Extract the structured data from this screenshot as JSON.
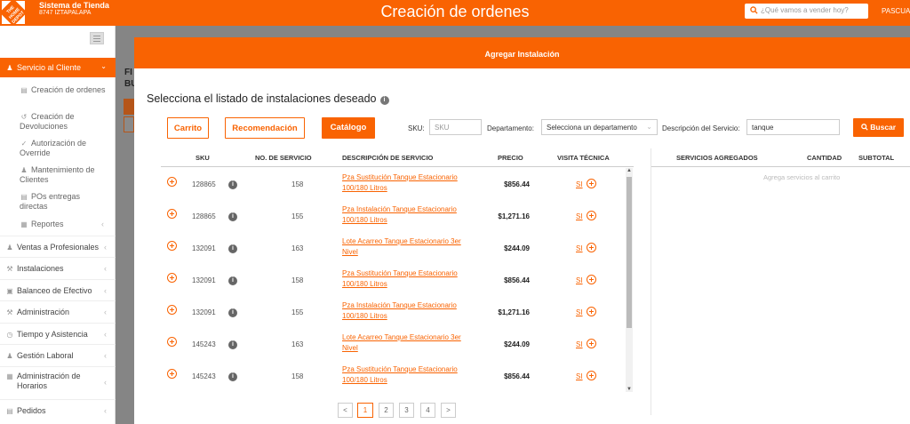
{
  "header": {
    "store_name": "Sistema de Tienda",
    "store_sub": "8747 IZTAPALAPA",
    "logo_text": "THE HOME DEPOT",
    "title": "Creación de ordenes",
    "search_placeholder": "¿Qué vamos a vender hoy?",
    "user": "PASCUAL",
    "brand_color": "#f96302"
  },
  "sidebar": {
    "active": "Servicio al Cliente",
    "subitems": [
      {
        "label": "Creación de ordenes",
        "icon": "list-icon"
      },
      {
        "label": "Creación de Devoluciones",
        "icon": "return-icon"
      },
      {
        "label": "Autorización de Override",
        "icon": "check-icon"
      },
      {
        "label": "Mantenimiento de Clientes",
        "icon": "person-icon"
      },
      {
        "label": "POs entregas directas",
        "icon": "list-icon"
      },
      {
        "label": "Reportes",
        "icon": "clipboard-icon"
      }
    ],
    "items": [
      {
        "label": "Ventas a Profesionales",
        "icon": "person-icon"
      },
      {
        "label": "Instalaciones",
        "icon": "wrench-icon"
      },
      {
        "label": "Balanceo de Efectivo",
        "icon": "cash-icon"
      },
      {
        "label": "Administración",
        "icon": "wrench-icon"
      },
      {
        "label": "Tiempo y Asistencia",
        "icon": "clock-icon"
      },
      {
        "label": "Gestión Laboral",
        "icon": "group-icon"
      },
      {
        "label": "Administración de Horarios",
        "icon": "calendar-icon"
      },
      {
        "label": "Pedidos",
        "icon": "document-icon"
      }
    ]
  },
  "background": {
    "text1": "FI",
    "text2": "BU"
  },
  "modal": {
    "header": "Agregar Instalación",
    "subtitle": "Selecciona el listado de instalaciones deseado",
    "buttons": {
      "carrito": "Carrito",
      "recomendacion": "Recomendación",
      "catalogo": "Catálogo",
      "buscar": "Buscar"
    },
    "filters": {
      "sku_label": "SKU:",
      "sku_placeholder": "SKU",
      "depto_label": "Departamento:",
      "depto_value": "Selecciona un departamento",
      "desc_label": "Descripción del Servicio:",
      "desc_value": "tanque"
    },
    "table": {
      "headers": {
        "sku": "SKU",
        "num": "NO. DE SERVICIO",
        "desc": "DESCRIPCIÓN DE SERVICIO",
        "precio": "PRECIO",
        "visita": "VISITA TÉCNICA"
      },
      "rows": [
        {
          "sku": "128865",
          "num": "158",
          "desc": "Pza Sustitución Tanque Estacionario 100/180 Litros",
          "precio": "$856.44",
          "visita": "SI"
        },
        {
          "sku": "128865",
          "num": "155",
          "desc": "Pza Instalación Tanque Estacionario 100/180 Litros",
          "precio": "$1,271.16",
          "visita": "SI"
        },
        {
          "sku": "132091",
          "num": "163",
          "desc": "Lote Acarreo Tanque Estacionario 3er Nivel",
          "precio": "$244.09",
          "visita": "SI"
        },
        {
          "sku": "132091",
          "num": "158",
          "desc": "Pza Sustitución Tanque Estacionario 100/180 Litros",
          "precio": "$856.44",
          "visita": "SI"
        },
        {
          "sku": "132091",
          "num": "155",
          "desc": "Pza Instalación Tanque Estacionario 100/180 Litros",
          "precio": "$1,271.16",
          "visita": "SI"
        },
        {
          "sku": "145243",
          "num": "163",
          "desc": "Lote Acarreo Tanque Estacionario 3er Nivel",
          "precio": "$244.09",
          "visita": "SI"
        },
        {
          "sku": "145243",
          "num": "158",
          "desc": "Pza Sustitución Tanque Estacionario 100/180 Litros",
          "precio": "$856.44",
          "visita": "SI"
        }
      ]
    },
    "cart": {
      "headers": {
        "servicios": "SERVICIOS AGREGADOS",
        "cantidad": "CANTIDAD",
        "subtotal": "SUBTOTAL"
      },
      "empty": "Agrega servicios al carrito"
    },
    "pagination": {
      "prev": "<",
      "next": ">",
      "pages": [
        "1",
        "2",
        "3",
        "4"
      ],
      "current": "1"
    }
  }
}
